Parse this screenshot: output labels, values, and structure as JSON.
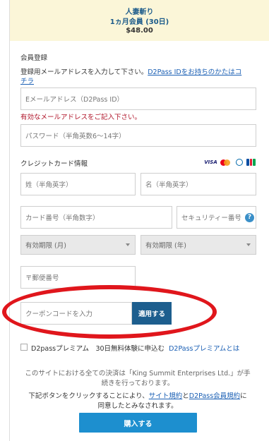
{
  "header": {
    "title": "人妻斬り",
    "plan": "1ヵ月会員 (30日)",
    "price": "$48.00"
  },
  "registration": {
    "section_label": "会員登録",
    "instruction": "登録用メールアドレスを入力して下さい。",
    "d2pass_link_line1": "D2Pass IDをお持ちのかたはコ",
    "d2pass_link_line2": "チラ",
    "email_placeholder": "Eメールアドレス（D2Pass ID）",
    "email_error": "有効なメールアドレスをご記入下さい。",
    "password_placeholder": "パスワード（半角英数6～14字）"
  },
  "credit_card": {
    "section_label": "クレジットカード情報",
    "brands": [
      "VISA",
      "MasterCard",
      "Diners",
      "JCB"
    ],
    "last_name_placeholder": "姓（半角英字）",
    "first_name_placeholder": "名（半角英字）",
    "card_number_placeholder": "カード番号（半角数字）",
    "security_code_placeholder": "セキュリティー番号",
    "help_icon": "?",
    "expiry_month": "有効期限 (月)",
    "expiry_year": "有効期限 (年)",
    "postal_code_placeholder": "〒郵便番号"
  },
  "coupon": {
    "placeholder": "クーポンコードを入力",
    "apply_label": "適用する"
  },
  "premium": {
    "checkbox_label": "D2passプレミアム　30日無料体験に申込む",
    "link_label": "D2Passプレミアムとは"
  },
  "notice": {
    "line1": "このサイトにおける全ての決済は「King Summit Enterprises Ltd.」が手",
    "line2": "続きを行っております。"
  },
  "terms": {
    "prefix": "下記ボタンをクリックすることにより、",
    "site_terms_link": "サイト規約",
    "and": "と",
    "d2pass_terms_link": "D2Pass会員規約",
    "suffix": "に",
    "line2": "同意したとみなされます。"
  },
  "buy_button_label": "購入する",
  "colors": {
    "header_bg": "#fbf6d8",
    "link": "#1a5fb4",
    "error": "#b0152a",
    "apply_button": "#1d5e8e",
    "buy_button": "#1d8fcf",
    "annotation_ellipse": "#e0161c"
  }
}
